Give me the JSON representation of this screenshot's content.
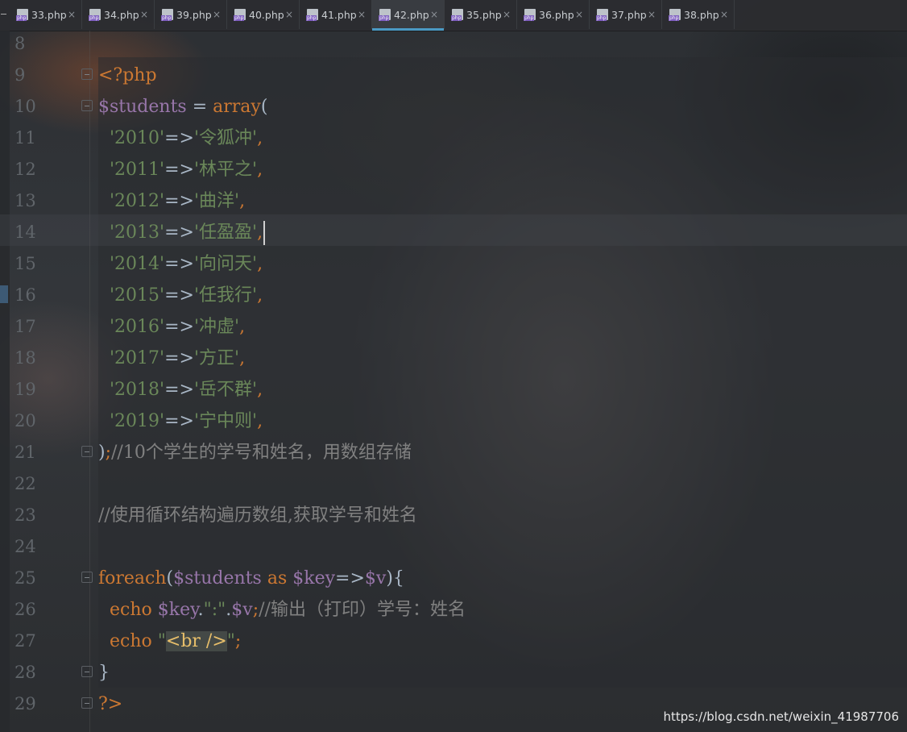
{
  "tabs": [
    {
      "label": "33.php",
      "active": false
    },
    {
      "label": "34.php",
      "active": false
    },
    {
      "label": "39.php",
      "active": false
    },
    {
      "label": "40.php",
      "active": false
    },
    {
      "label": "41.php",
      "active": false
    },
    {
      "label": "42.php",
      "active": true
    },
    {
      "label": "35.php",
      "active": false
    },
    {
      "label": "36.php",
      "active": false
    },
    {
      "label": "37.php",
      "active": false
    },
    {
      "label": "38.php",
      "active": false
    }
  ],
  "tab_icon": "php-file-icon",
  "tab_close_glyph": "×",
  "editor": {
    "line_numbers": [
      "8",
      "9",
      "10",
      "11",
      "12",
      "13",
      "14",
      "15",
      "16",
      "17",
      "18",
      "19",
      "20",
      "21",
      "22",
      "23",
      "24",
      "25",
      "26",
      "27",
      "28",
      "29"
    ],
    "lines": {
      "l9": {
        "open": "<?php"
      },
      "l10": {
        "var": "$students",
        "eq": " = ",
        "fn": "array",
        "paren": "("
      },
      "l11": {
        "key": "'2010'",
        "arrow": "=>",
        "val": "'令狐冲'",
        "comma": ","
      },
      "l12": {
        "key": "'2011'",
        "arrow": "=>",
        "val": "'林平之'",
        "comma": ","
      },
      "l13": {
        "key": "'2012'",
        "arrow": "=>",
        "val": "'曲洋'",
        "comma": ","
      },
      "l14": {
        "key": "'2013'",
        "arrow": "=>",
        "val": "'任盈盈'",
        "comma": ","
      },
      "l15": {
        "key": "'2014'",
        "arrow": "=>",
        "val": "'向问天'",
        "comma": ","
      },
      "l16": {
        "key": "'2015'",
        "arrow": "=>",
        "val": "'任我行'",
        "comma": ","
      },
      "l17": {
        "key": "'2016'",
        "arrow": "=>",
        "val": "'冲虚'",
        "comma": ","
      },
      "l18": {
        "key": "'2017'",
        "arrow": "=>",
        "val": "'方正'",
        "comma": ","
      },
      "l19": {
        "key": "'2018'",
        "arrow": "=>",
        "val": "'岳不群'",
        "comma": ","
      },
      "l20": {
        "key": "'2019'",
        "arrow": "=>",
        "val": "'宁中则'",
        "comma": ","
      },
      "l21": {
        "close": ")",
        "semi": ";",
        "comment": "//10个学生的学号和姓名，用数组存储"
      },
      "l23": {
        "comment": "//使用循环结构遍历数组,获取学号和姓名"
      },
      "l25": {
        "kw": "foreach",
        "open": "(",
        "var1": "$students",
        "as": "as",
        "var2": "$key",
        "arrow": "=>",
        "var3": "$v",
        "close": "){"
      },
      "l26": {
        "kw": "echo",
        "var1": "$key",
        "dot1": ".",
        "str": "\":\"",
        "dot2": ".",
        "var2": "$v",
        "semi": ";",
        "comment": "//输出（打印）学号：姓名"
      },
      "l27": {
        "kw": "echo",
        "q1": "\"",
        "tag": "<br />",
        "q2": "\"",
        "semi": ";"
      },
      "l28": {
        "close": "}"
      },
      "l29": {
        "end": "?>"
      }
    }
  },
  "watermark": "https://blog.csdn.net/weixin_41987706"
}
